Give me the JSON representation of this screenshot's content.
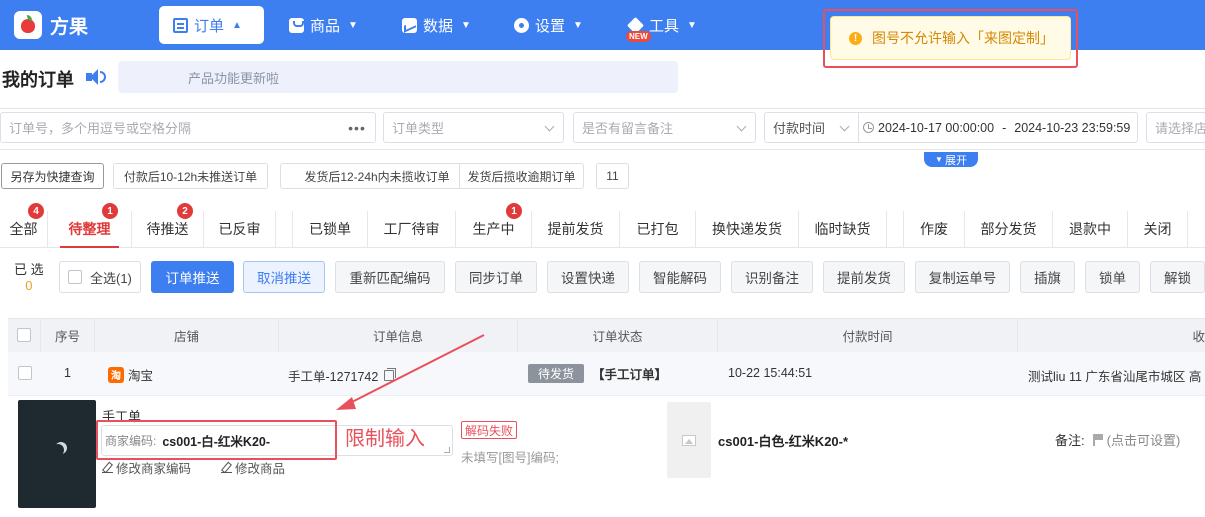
{
  "app": {
    "name": "方果"
  },
  "nav": [
    {
      "label": "订单",
      "caret": "▲"
    },
    {
      "label": "商品",
      "caret": "▼"
    },
    {
      "label": "数据",
      "caret": "▼"
    },
    {
      "label": "设置",
      "caret": "▼"
    },
    {
      "label": "工具",
      "caret": "▼",
      "badge": "NEW"
    }
  ],
  "toast": {
    "message": "图号不允许输入「来图定制」"
  },
  "page": {
    "title": "我的订单",
    "announcement": "产品功能更新啦"
  },
  "filters": {
    "order_no_placeholder": "订单号，多个用逗号或空格分隔",
    "more": "•••",
    "order_type_placeholder": "订单类型",
    "remark_placeholder": "是否有留言备注",
    "time_type": "付款时间",
    "date_start": "2024-10-17 00:00:00",
    "date_sep": "-",
    "date_end": "2024-10-23 23:59:59",
    "shop_placeholder": "请选择店铺",
    "expand": "展开",
    "expand_icon": "▼"
  },
  "quick_queries": [
    "另存为快捷查询",
    "付款后10-12h未推送订单",
    "发货后12-24h内未揽收订单",
    "发货后揽收逾期订单",
    "11"
  ],
  "status_tabs": [
    {
      "label": "全部",
      "badge": "4"
    },
    {
      "label": "待整理",
      "badge": "1"
    },
    {
      "label": "待推送",
      "badge": "2"
    },
    {
      "label": "已反审"
    },
    {
      "label": "已锁单"
    },
    {
      "label": "工厂待审"
    },
    {
      "label": "生产中",
      "badge": "1"
    },
    {
      "label": "提前发货"
    },
    {
      "label": "已打包"
    },
    {
      "label": "换快递发货"
    },
    {
      "label": "临时缺货"
    },
    {
      "label": "作废"
    },
    {
      "label": "部分发货"
    },
    {
      "label": "退款中"
    },
    {
      "label": "关闭"
    }
  ],
  "actions": {
    "selected_label": "已 选",
    "selected_count": "0",
    "select_all": "全选(1)",
    "buttons": [
      "订单推送",
      "取消推送",
      "重新匹配编码",
      "同步订单",
      "设置快递",
      "智能解码",
      "识别备注",
      "提前发货",
      "复制运单号",
      "插旗",
      "锁单",
      "解锁"
    ]
  },
  "table": {
    "headers": [
      "序号",
      "店铺",
      "订单信息",
      "订单状态",
      "付款时间",
      "收"
    ],
    "row": {
      "index": "1",
      "shop_icon": "淘",
      "shop": "淘宝",
      "order_info": "手工单-1271742",
      "status": "待发货",
      "order_tag": "【手工订单】",
      "pay_time": "10-22 15:44:51",
      "receiver": "测试liu  11  广东省汕尾市城区 高"
    }
  },
  "detail": {
    "product_name": "手工单",
    "code_label": "商家编码:",
    "code_value": "cs001-白-红米K20-",
    "annotation": "限制输入",
    "decode_error": "解码失败",
    "edit_code": "修改商家编码",
    "edit_goods": "修改商品",
    "hint": "未填写[图号]编码;",
    "sku": "cs001-白色-红米K20-*",
    "remark_label": "备注:",
    "remark_action": "(点击可设置)"
  },
  "colors": {
    "brand": "#3d7ef0",
    "danger": "#e13a3a",
    "annotation": "#e8505b",
    "warning": "#d48806"
  }
}
